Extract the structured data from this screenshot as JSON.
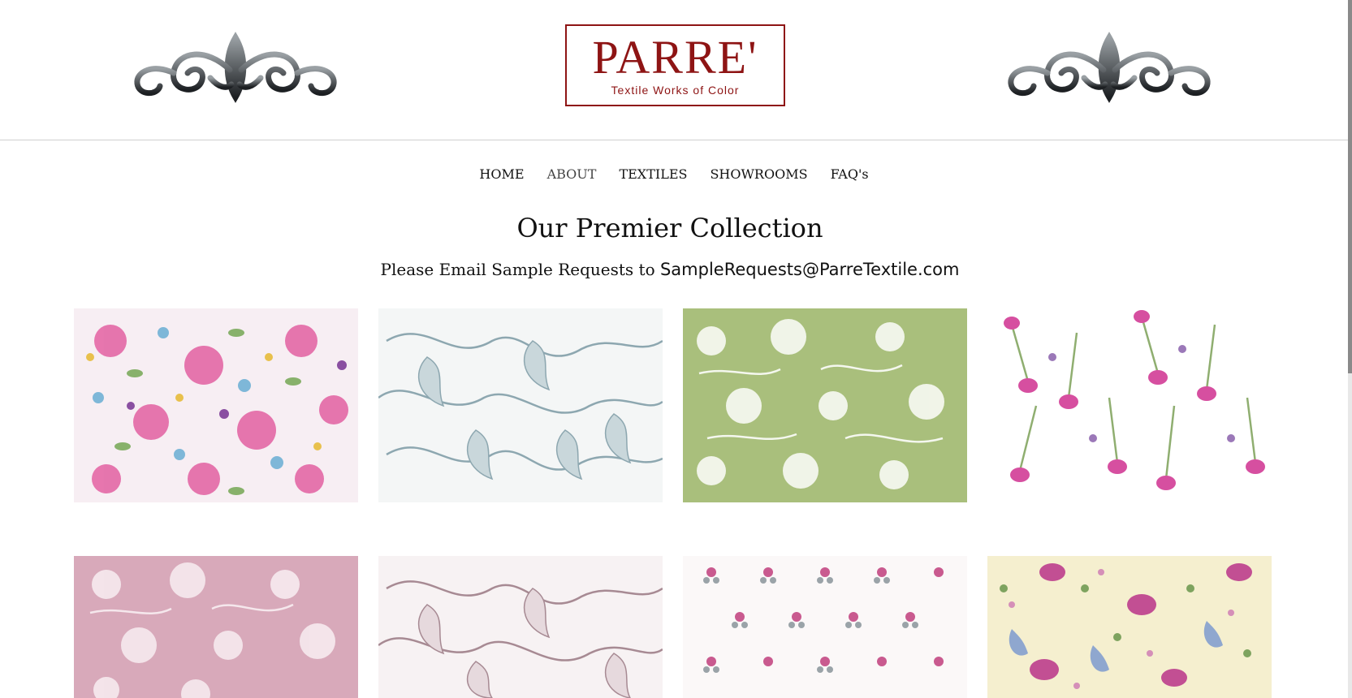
{
  "brand": {
    "name": "PARRE'",
    "tagline": "Textile Works of Color",
    "color": "#8e1414"
  },
  "nav": {
    "items": [
      {
        "label": "HOME"
      },
      {
        "label": "ABOUT"
      },
      {
        "label": "TEXTILES"
      },
      {
        "label": "SHOWROOMS"
      },
      {
        "label": "FAQ's"
      }
    ]
  },
  "page": {
    "title": "Our Premier Collection",
    "subtitle_prefix": "Please Email Sample Requests to",
    "email": "SampleRequests@ParreTextile.com"
  },
  "gallery": {
    "tiles": [
      {
        "pattern": "multicolor-floral",
        "background": "#f7eef3"
      },
      {
        "pattern": "blue-acanthus-leaves",
        "background": "#f4f6f6"
      },
      {
        "pattern": "white-floral-on-green",
        "background": "#a9bf7c"
      },
      {
        "pattern": "pink-thistle-stems",
        "background": "#ffffff"
      },
      {
        "pattern": "white-floral-on-pink",
        "background": "#d8a9ba"
      },
      {
        "pattern": "mauve-acanthus-leaves",
        "background": "#f7f2f3"
      },
      {
        "pattern": "small-pink-bouquets",
        "background": "#fbf8f8"
      },
      {
        "pattern": "jacobean-floral-on-cream",
        "background": "#f5efcf"
      }
    ]
  }
}
